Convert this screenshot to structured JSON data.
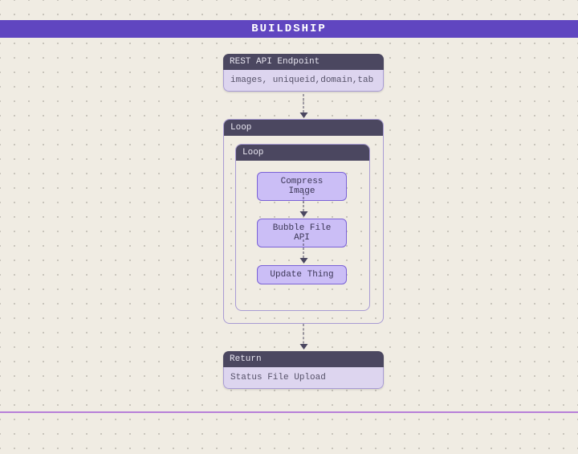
{
  "header": {
    "title": "BUILDSHIP"
  },
  "endpoint": {
    "title": "REST API Endpoint",
    "params": "images, uniqueid,domain,tab"
  },
  "loopOuter": {
    "title": "Loop"
  },
  "loopInner": {
    "title": "Loop"
  },
  "steps": {
    "compress": "Compress Image",
    "bubble": "Bubble File API",
    "update": "Update Thing"
  },
  "return": {
    "title": "Return",
    "body": "Status File Upload"
  }
}
